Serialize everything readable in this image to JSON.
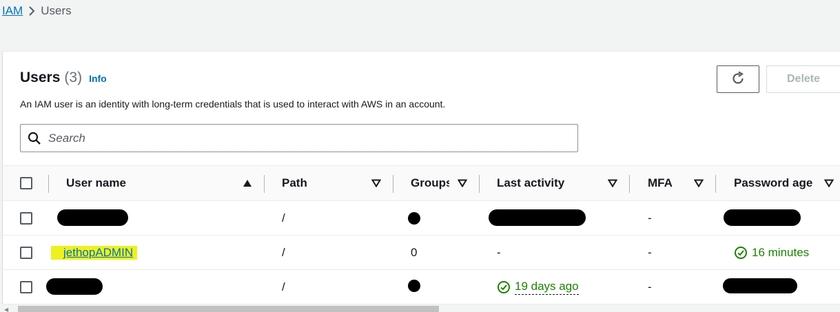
{
  "breadcrumb": {
    "root": "IAM",
    "current": "Users"
  },
  "header": {
    "title": "Users",
    "count": "(3)",
    "info": "Info",
    "description": "An IAM user is an identity with long-term credentials that is used to interact with AWS in an account.",
    "delete_label": "Delete"
  },
  "search": {
    "placeholder": "Search"
  },
  "table": {
    "columns": [
      "User name",
      "Path",
      "Groups",
      "Last activity",
      "MFA",
      "Password age"
    ],
    "rows": [
      {
        "user_name": "",
        "path": "/",
        "groups": "",
        "last_activity": "",
        "mfa": "-",
        "password_age": ""
      },
      {
        "user_name": "jethopADMIN",
        "path": "/",
        "groups": "0",
        "last_activity": "-",
        "mfa": "-",
        "password_age": "16 minutes"
      },
      {
        "user_name": "",
        "path": "/",
        "groups": "",
        "last_activity": "19 days ago",
        "mfa": "-",
        "password_age": ""
      }
    ]
  },
  "colors": {
    "link": "#0073bb",
    "success": "#1d8102",
    "highlight": "#eef020"
  }
}
